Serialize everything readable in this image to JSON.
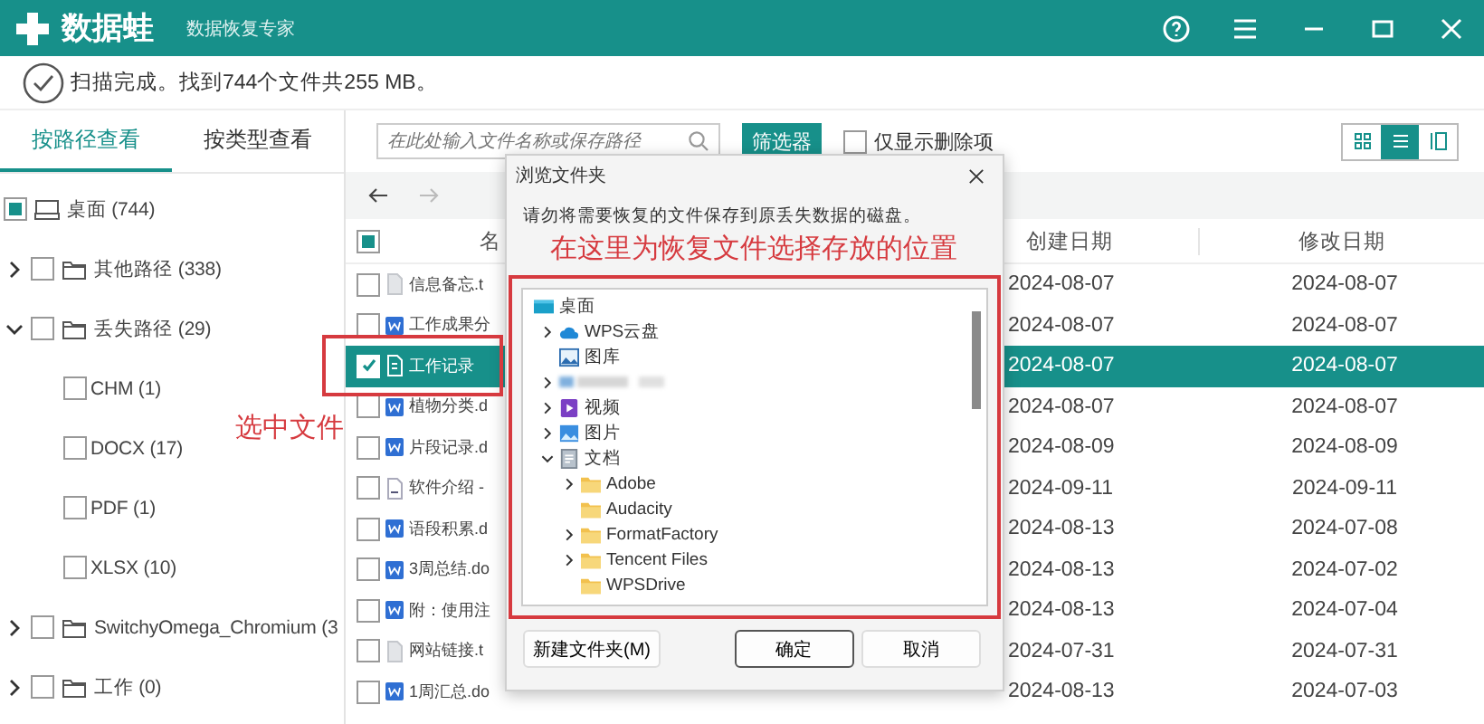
{
  "app": {
    "logo": "数据蛙",
    "subtitle": "数据恢复专家"
  },
  "status": "扫描完成。找到744个文件共255 MB。",
  "tabs": [
    {
      "label": "按路径查看",
      "selected": true
    },
    {
      "label": "按类型查看",
      "selected": false
    }
  ],
  "search": {
    "placeholder": "在此处输入文件名称或保存路径"
  },
  "filter_button": "筛选器",
  "deleted_only": {
    "label": "仅显示删除项",
    "checked": false
  },
  "views": [
    {
      "kind": "grid",
      "selected": false
    },
    {
      "kind": "list",
      "selected": true
    },
    {
      "kind": "preview",
      "selected": false
    }
  ],
  "tree": [
    {
      "label": "桌面 (744)",
      "kind": "drive",
      "checked": false,
      "partial": true,
      "children": [
        {
          "label": "其他路径 (338)",
          "kind": "folder",
          "checked": false,
          "expanded": false
        },
        {
          "label": "丢失路径 (29)",
          "kind": "folder",
          "checked": false,
          "expanded": true,
          "children": [
            {
              "label": "CHM (1)",
              "checked": false
            },
            {
              "label": "DOCX (17)",
              "checked": false
            },
            {
              "label": "PDF (1)",
              "checked": false
            },
            {
              "label": "XLSX (10)",
              "checked": false
            }
          ]
        },
        {
          "label": "SwitchyOmega_Chromium (3",
          "kind": "folder",
          "checked": false,
          "expanded": false
        },
        {
          "label": "工作 (0)",
          "kind": "folder",
          "checked": false,
          "expanded": false
        }
      ]
    }
  ],
  "table": {
    "partial": true,
    "columns": [
      "名",
      "创建日期",
      "修改日期"
    ],
    "rows": [
      {
        "name": "信息备忘.t",
        "kind": "text",
        "checked": false,
        "selected": false,
        "created": "2024-08-07",
        "modified": "2024-08-07"
      },
      {
        "name": "工作成果分",
        "kind": "word",
        "checked": false,
        "selected": false,
        "created": "2024-08-07",
        "modified": "2024-08-07"
      },
      {
        "name": "工作记录",
        "kind": "doc",
        "checked": true,
        "selected": true,
        "created": "2024-08-07",
        "modified": "2024-08-07"
      },
      {
        "name": "植物分类.d",
        "kind": "word",
        "checked": false,
        "selected": false,
        "created": "2024-08-07",
        "modified": "2024-08-07"
      },
      {
        "name": "片段记录.d",
        "kind": "word",
        "checked": false,
        "selected": false,
        "created": "2024-08-09",
        "modified": "2024-08-09"
      },
      {
        "name": "软件介绍 -",
        "kind": "plain",
        "checked": false,
        "selected": false,
        "created": "2024-09-11",
        "modified": "2024-09-11"
      },
      {
        "name": "语段积累.d",
        "kind": "word",
        "checked": false,
        "selected": false,
        "created": "2024-08-13",
        "modified": "2024-07-08"
      },
      {
        "name": "3周总结.do",
        "kind": "word",
        "checked": false,
        "selected": false,
        "created": "2024-08-13",
        "modified": "2024-07-02"
      },
      {
        "name": "附：使用注",
        "kind": "word",
        "checked": false,
        "selected": false,
        "created": "2024-08-13",
        "modified": "2024-07-04"
      },
      {
        "name": "网站链接.t",
        "kind": "text",
        "checked": false,
        "selected": false,
        "created": "2024-07-31",
        "modified": "2024-07-31"
      },
      {
        "name": "1周汇总.do",
        "kind": "word",
        "checked": false,
        "selected": false,
        "created": "2024-08-13",
        "modified": "2024-07-03"
      }
    ]
  },
  "dialog": {
    "title": "浏览文件夹",
    "message": "请勿将需要恢复的文件保存到原丢失数据的磁盘。",
    "tree": [
      {
        "label": "桌面",
        "kind": "desktop",
        "children": [
          {
            "label": "WPS云盘",
            "kind": "cloud",
            "expanded": false
          },
          {
            "label": "图库",
            "kind": "gallery"
          },
          {
            "kind": "blurred",
            "expanded": false
          },
          {
            "label": "视频",
            "kind": "video",
            "expanded": false
          },
          {
            "label": "图片",
            "kind": "pictures",
            "expanded": false
          },
          {
            "label": "文档",
            "kind": "documents",
            "expanded": true,
            "children": [
              {
                "label": "Adobe",
                "kind": "folder",
                "expanded": false
              },
              {
                "label": "Audacity",
                "kind": "folder"
              },
              {
                "label": "FormatFactory",
                "kind": "folder",
                "expanded": false
              },
              {
                "label": "Tencent Files",
                "kind": "folder",
                "expanded": false
              },
              {
                "label": "WPSDrive",
                "kind": "folder"
              }
            ]
          }
        ]
      }
    ],
    "buttons": [
      {
        "label": "新建文件夹(M)",
        "default": false
      },
      {
        "label": "确定",
        "default": true
      },
      {
        "label": "取消",
        "default": false
      }
    ]
  },
  "annotations": [
    {
      "kind": "row",
      "text": "选中文件"
    },
    {
      "kind": "tree",
      "text": "在这里为恢复文件选择存放的位置"
    }
  ]
}
